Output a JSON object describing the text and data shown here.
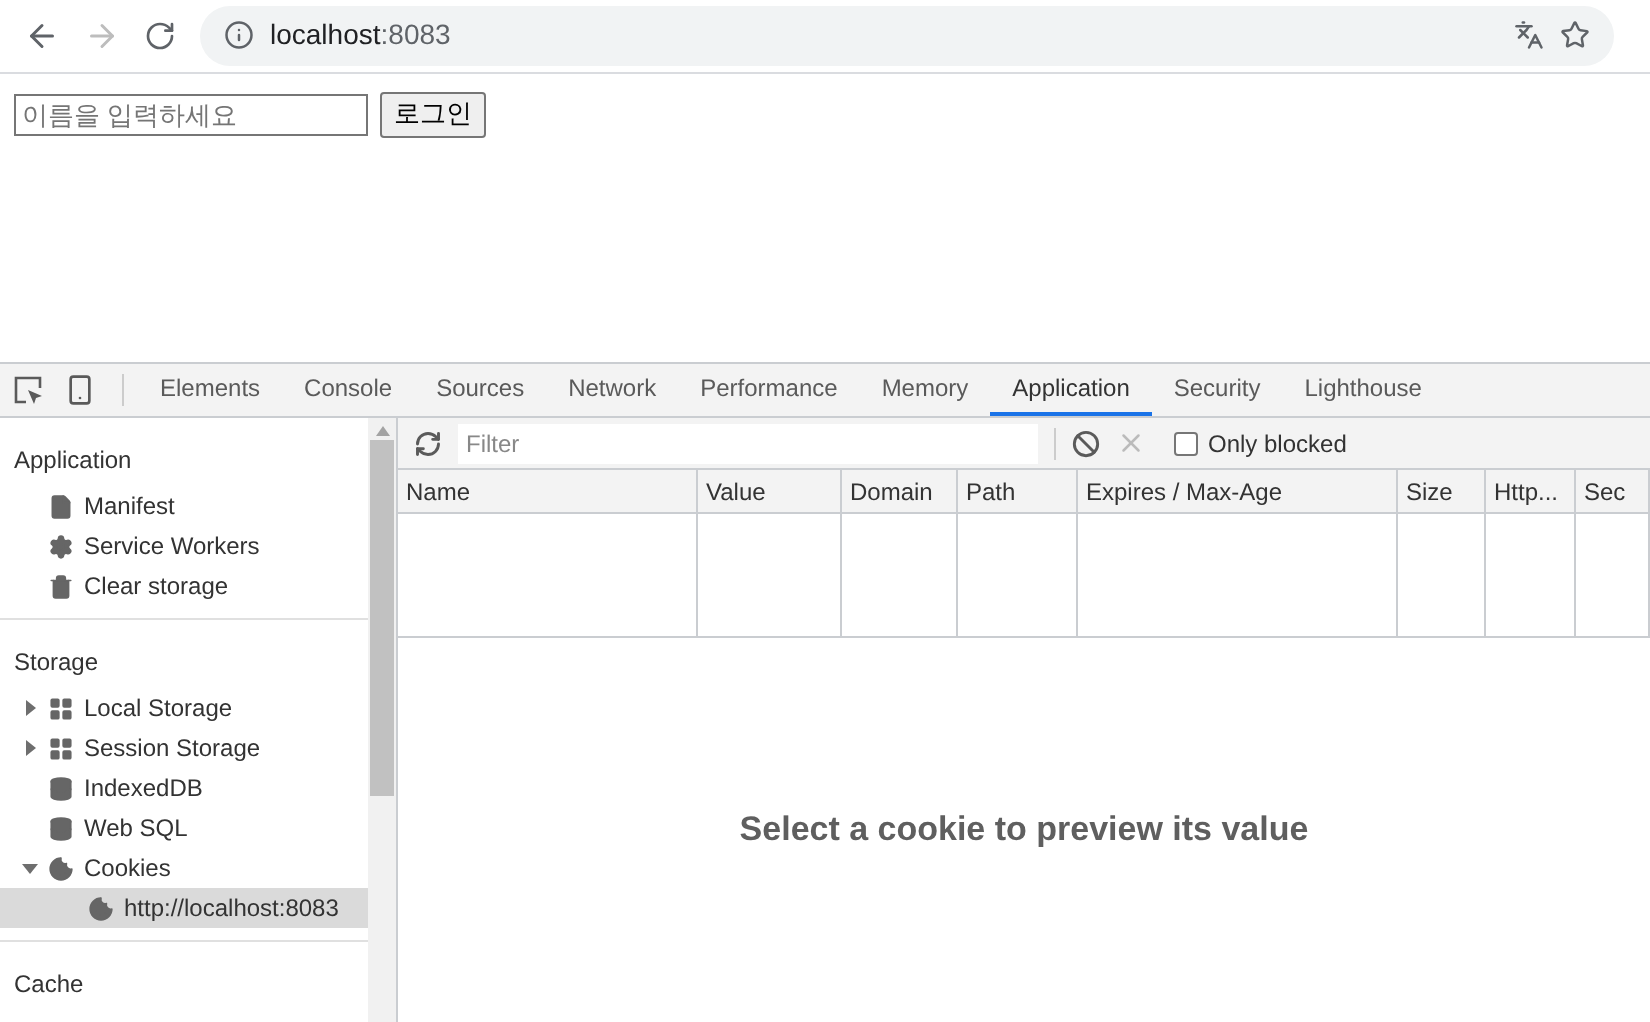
{
  "browser": {
    "url_host": "localhost",
    "url_port": ":8083"
  },
  "page": {
    "name_field": {
      "placeholder": "이름을 입력하세요"
    },
    "login_button": "로그인"
  },
  "devtools": {
    "tabs": [
      {
        "label": "Elements",
        "selected": false
      },
      {
        "label": "Console",
        "selected": false
      },
      {
        "label": "Sources",
        "selected": false
      },
      {
        "label": "Network",
        "selected": false
      },
      {
        "label": "Performance",
        "selected": false
      },
      {
        "label": "Memory",
        "selected": false
      },
      {
        "label": "Application",
        "selected": true
      },
      {
        "label": "Security",
        "selected": false
      },
      {
        "label": "Lighthouse",
        "selected": false
      }
    ],
    "sidebar": {
      "sections": [
        {
          "title": "Application",
          "items": [
            {
              "label": "Manifest",
              "kind": "file",
              "selected": false
            },
            {
              "label": "Service Workers",
              "kind": "gear",
              "selected": false
            },
            {
              "label": "Clear storage",
              "kind": "trash",
              "selected": false
            }
          ]
        },
        {
          "title": "Storage",
          "items": [
            {
              "label": "Local Storage",
              "kind": "grid",
              "expanded": false,
              "selected": false
            },
            {
              "label": "Session Storage",
              "kind": "grid",
              "expanded": false,
              "selected": false
            },
            {
              "label": "IndexedDB",
              "kind": "database",
              "selected": false
            },
            {
              "label": "Web SQL",
              "kind": "database",
              "selected": false
            },
            {
              "label": "Cookies",
              "kind": "cookie",
              "expanded": true,
              "selected": false,
              "children": [
                {
                  "label": "http://localhost:8083",
                  "kind": "cookie",
                  "selected": true
                }
              ]
            }
          ]
        },
        {
          "title": "Cache"
        }
      ]
    },
    "toolbar": {
      "filter": {
        "placeholder": "Filter"
      },
      "only_blocked": {
        "label": "Only blocked",
        "checked": false
      }
    },
    "table": {
      "columns": [
        "Name",
        "Value",
        "Domain",
        "Path",
        "Expires / Max-Age",
        "Size",
        "Http...",
        "Sec"
      ]
    },
    "preview_message": "Select a cookie to preview its value"
  }
}
